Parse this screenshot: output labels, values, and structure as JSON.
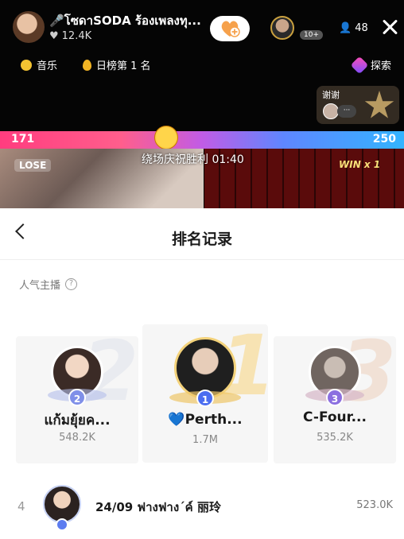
{
  "stream": {
    "host_name": "🎤โซดาSODA ร้องเพลงทุ...",
    "host_likes": "12.4K",
    "viewer_badge": "10+",
    "viewer_count": "48",
    "chip_music": "音乐",
    "chip_daily": "日榜第 1 名",
    "chip_explore": "探索",
    "thanks_label": "谢谢",
    "thanks_more": "···",
    "pk_left_score": "171",
    "pk_right_score": "250",
    "lose_label": "LOSE",
    "win_label": "WIN x 1",
    "celebrate_text": "绕场庆祝胜利 01:40"
  },
  "sheet": {
    "title": "排名记录",
    "section_label": "人气主播",
    "help_glyph": "?"
  },
  "podium": [
    {
      "rank": "2",
      "big_number": "2",
      "name": "แก้มยุ้ยค...",
      "score": "548.2K",
      "badge_color": "#7f8fe8"
    },
    {
      "rank": "1",
      "big_number": "1",
      "name": "💙Perth...",
      "score": "1.7M",
      "badge_color": "#4b6df0"
    },
    {
      "rank": "3",
      "big_number": "3",
      "name": "C-Four...",
      "score": "535.2K",
      "badge_color": "#8b6fe0"
    }
  ],
  "list": [
    {
      "rank": "4",
      "name": "24/09 ฟางฟาง´ค์ 丽玲",
      "score": "523.0K"
    }
  ]
}
